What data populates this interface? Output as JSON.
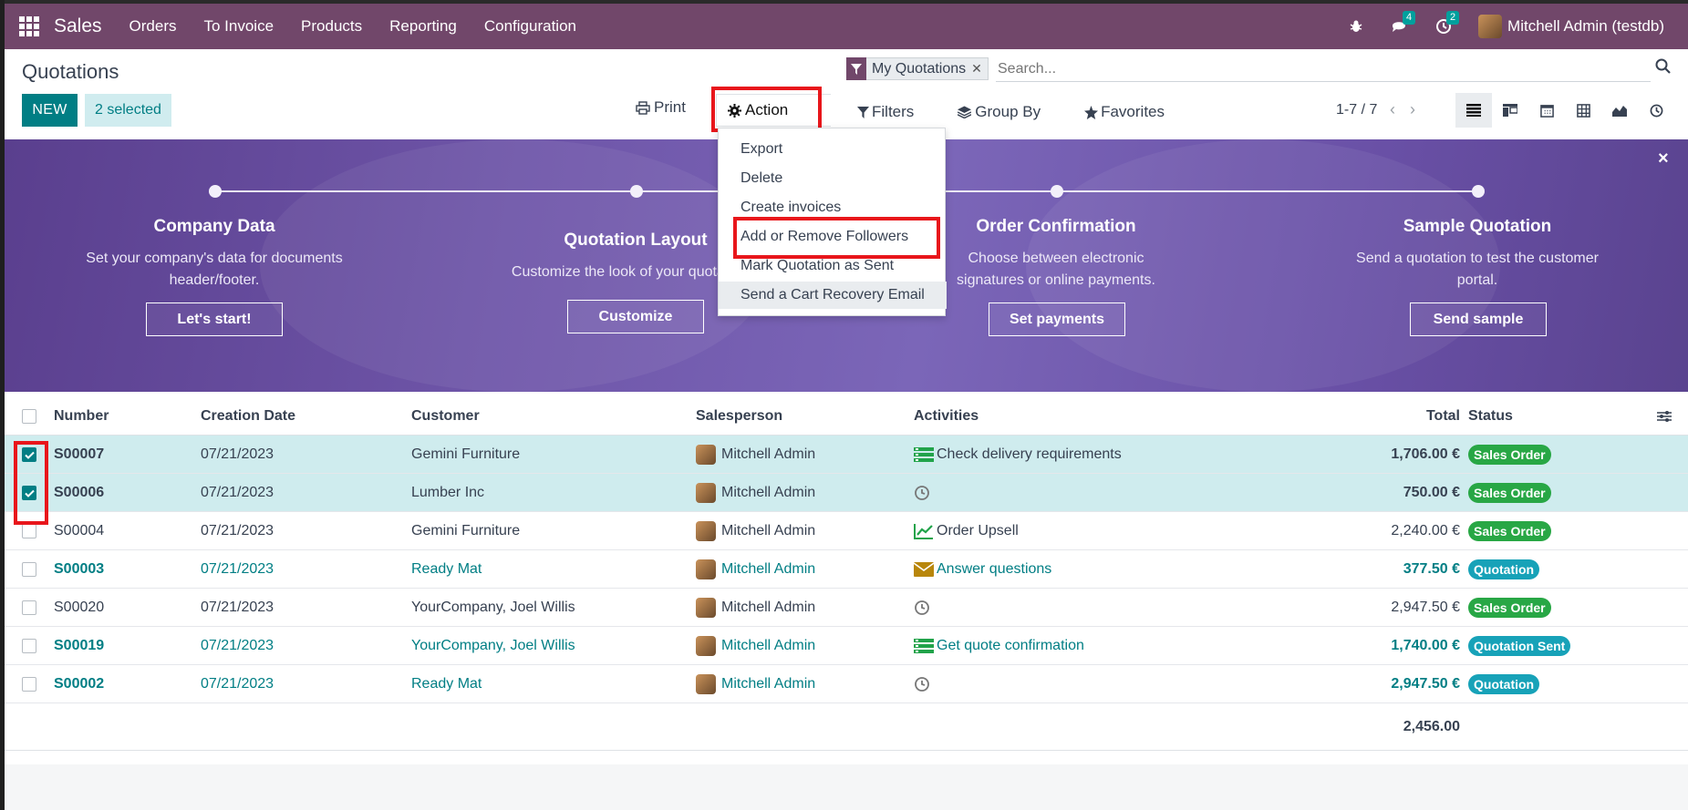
{
  "navbar": {
    "brand": "Sales",
    "menu": [
      "Orders",
      "To Invoice",
      "Products",
      "Reporting",
      "Configuration"
    ],
    "messages_count": "4",
    "activities_count": "2",
    "user": "Mitchell Admin (testdb)"
  },
  "control_panel": {
    "title": "Quotations",
    "new_label": "NEW",
    "selected_label": "2 selected",
    "print_label": "Print",
    "action_label": "Action",
    "facet_label": "My Quotations",
    "search_placeholder": "Search...",
    "filters_label": "Filters",
    "group_by_label": "Group By",
    "favorites_label": "Favorites",
    "pager": "1-7 / 7"
  },
  "action_menu": {
    "items": [
      "Export",
      "Delete",
      "Create invoices",
      "Add or Remove Followers",
      "Mark Quotation as Sent",
      "Send a Cart Recovery Email"
    ]
  },
  "banner": {
    "close": "×",
    "steps": [
      {
        "title": "Company Data",
        "desc": "Set your company's data for documents header/footer.",
        "button": "Let's start!"
      },
      {
        "title": "Quotation Layout",
        "desc": "Customize the look of your quotations.",
        "button": "Customize"
      },
      {
        "title": "Order Confirmation",
        "desc": "Choose between electronic signatures or online payments.",
        "button": "Set payments"
      },
      {
        "title": "Sample Quotation",
        "desc": "Send a quotation to test the customer portal.",
        "button": "Send sample"
      }
    ]
  },
  "table": {
    "headers": {
      "number": "Number",
      "date": "Creation Date",
      "customer": "Customer",
      "salesperson": "Salesperson",
      "activities": "Activities",
      "total": "Total",
      "status": "Status"
    },
    "rows": [
      {
        "number": "S00007",
        "date": "07/21/2023",
        "customer": "Gemini Furniture",
        "salesperson": "Mitchell Admin",
        "activity": "Check delivery requirements",
        "activity_icon": "tasks-icon",
        "total": "1,706.00 €",
        "status": "Sales Order",
        "status_color": "#28a745"
      },
      {
        "number": "S00006",
        "date": "07/21/2023",
        "customer": "Lumber Inc",
        "salesperson": "Mitchell Admin",
        "activity": "",
        "activity_icon": "clock-icon",
        "total": "750.00 €",
        "status": "Sales Order",
        "status_color": "#28a745"
      },
      {
        "number": "S00004",
        "date": "07/21/2023",
        "customer": "Gemini Furniture",
        "salesperson": "Mitchell Admin",
        "activity": "Order Upsell",
        "activity_icon": "chart-icon",
        "total": "2,240.00 €",
        "status": "Sales Order",
        "status_color": "#28a745"
      },
      {
        "number": "S00003",
        "date": "07/21/2023",
        "customer": "Ready Mat",
        "salesperson": "Mitchell Admin",
        "activity": "Answer questions",
        "activity_icon": "envelope-icon",
        "total": "377.50 €",
        "status": "Quotation",
        "status_color": "#17a2b8"
      },
      {
        "number": "S00020",
        "date": "07/21/2023",
        "customer": "YourCompany, Joel Willis",
        "salesperson": "Mitchell Admin",
        "activity": "",
        "activity_icon": "clock-icon",
        "total": "2,947.50 €",
        "status": "Sales Order",
        "status_color": "#28a745"
      },
      {
        "number": "S00019",
        "date": "07/21/2023",
        "customer": "YourCompany, Joel Willis",
        "salesperson": "Mitchell Admin",
        "activity": "Get quote confirmation",
        "activity_icon": "tasks-icon",
        "total": "1,740.00 €",
        "status": "Quotation Sent",
        "status_color": "#17a2b8"
      },
      {
        "number": "S00002",
        "date": "07/21/2023",
        "customer": "Ready Mat",
        "salesperson": "Mitchell Admin",
        "activity": "",
        "activity_icon": "clock-icon",
        "total": "2,947.50 €",
        "status": "Quotation",
        "status_color": "#17a2b8"
      }
    ],
    "sum_total": "2,456.00"
  }
}
